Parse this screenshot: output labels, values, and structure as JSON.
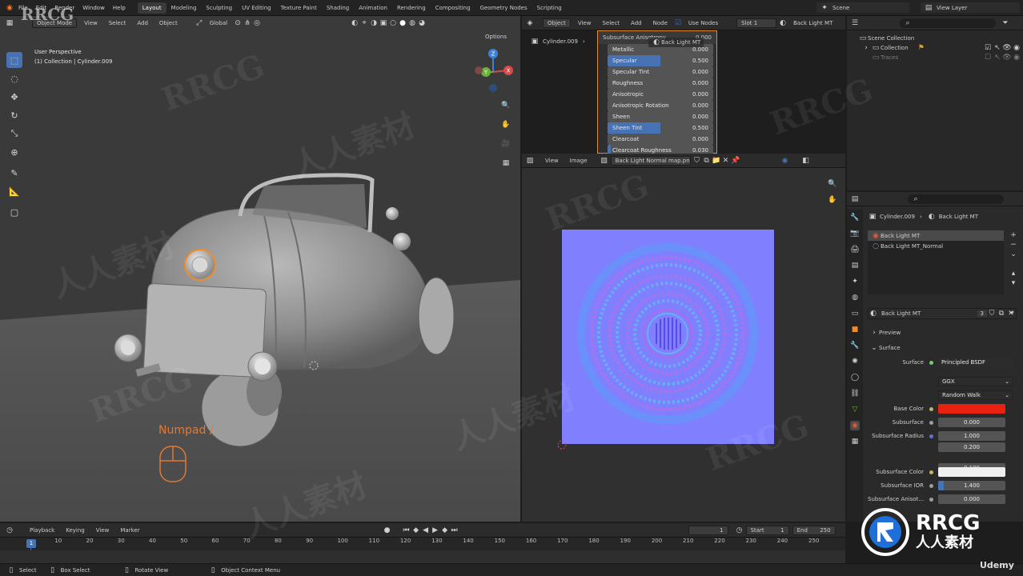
{
  "topbar": {
    "menus": [
      "File",
      "Edit",
      "Render",
      "Window",
      "Help"
    ],
    "workspaces": [
      "Layout",
      "Modeling",
      "Sculpting",
      "UV Editing",
      "Texture Paint",
      "Shading",
      "Animation",
      "Rendering",
      "Compositing",
      "Geometry Nodes",
      "Scripting"
    ],
    "active_workspace": "Layout",
    "scene": "Scene",
    "view_layer": "View Layer"
  },
  "viewport": {
    "mode": "Object Mode",
    "menus": [
      "View",
      "Select",
      "Add",
      "Object"
    ],
    "orientation": "Global",
    "options_label": "Options",
    "overlay_line1": "User Perspective",
    "overlay_line2": "(1) Collection | Cylinder.009",
    "key_hint": "Numpad /",
    "gizmo": {
      "x": "X",
      "y": "Y",
      "z": "Z"
    }
  },
  "shader_editor": {
    "mode": "Object",
    "menus": [
      "View",
      "Select",
      "Add",
      "Node"
    ],
    "use_nodes": "Use Nodes",
    "slot": "Slot 1",
    "material": "Back Light MT",
    "breadcrumb_object": "Cylinder.009",
    "breadcrumb_material": "Back Light MT",
    "node_title": "Subsurface Anisotropy",
    "node_title_value": "0.000",
    "rows": [
      {
        "label": "Metallic",
        "value": "0.000",
        "fill": 0
      },
      {
        "label": "Specular",
        "value": "0.500",
        "fill": 0.5
      },
      {
        "label": "Specular Tint",
        "value": "0.000",
        "fill": 0
      },
      {
        "label": "Roughness",
        "value": "0.000",
        "fill": 0
      },
      {
        "label": "Anisotropic",
        "value": "0.000",
        "fill": 0
      },
      {
        "label": "Anisotropic Rotation",
        "value": "0.000",
        "fill": 0
      },
      {
        "label": "Sheen",
        "value": "0.000",
        "fill": 0
      },
      {
        "label": "Sheen Tint",
        "value": "0.500",
        "fill": 0.5
      },
      {
        "label": "Clearcoat",
        "value": "0.000",
        "fill": 0
      },
      {
        "label": "Clearcoat Roughness",
        "value": "0.030",
        "fill": 0.03
      }
    ]
  },
  "image_editor": {
    "menus": [
      "View",
      "Image"
    ],
    "image_name": "Back Light Normal map.png"
  },
  "outliner": {
    "root": "Scene Collection",
    "collection": "Collection",
    "child": "Traces"
  },
  "properties": {
    "breadcrumb_object": "Cylinder.009",
    "breadcrumb_material": "Back Light MT",
    "slots": [
      "Back Light MT",
      "Back Light MT_Normal"
    ],
    "material_name": "Back Light MT",
    "user_count": "3",
    "preview_label": "Preview",
    "surface_label": "Surface",
    "surface_field_label": "Surface",
    "surface_value": "Principled BSDF",
    "distribution": "GGX",
    "subsurface_method": "Random Walk",
    "base_color_label": "Base Color",
    "base_color": "#e8220e",
    "subsurface_label": "Subsurface",
    "subsurface_value": "0.000",
    "subsurface_radius_label": "Subsurface Radius",
    "radius": [
      "1.000",
      "0.200",
      "0.100"
    ],
    "subsurface_color_label": "Subsurface Color",
    "subsurface_color": "#efefef",
    "subsurface_ior_label": "Subsurface IOR",
    "subsurface_ior_value": "1.400",
    "subsurface_aniso_label": "Subsurface Anisot...",
    "subsurface_aniso_value": "0.000"
  },
  "timeline": {
    "menus": [
      "Playback",
      "Keying",
      "View",
      "Marker"
    ],
    "current_frame": "1",
    "start_label": "Start",
    "start": "1",
    "end_label": "End",
    "end": "250",
    "ticks": [
      "10",
      "20",
      "30",
      "40",
      "50",
      "60",
      "70",
      "80",
      "90",
      "100",
      "110",
      "120",
      "130",
      "140",
      "150",
      "160",
      "170",
      "180",
      "190",
      "200",
      "210",
      "220",
      "230",
      "240",
      "250"
    ]
  },
  "statusbar": {
    "select": "Select",
    "box_select": "Box Select",
    "rotate_view": "Rotate View",
    "context_menu": "Object Context Menu"
  },
  "watermarks": {
    "rrcg": "RRCG",
    "cn": "人人素材",
    "udemy": "Udemy"
  },
  "colors": {
    "accent": "#4772b3",
    "selection": "#f28c2a",
    "normal_map": "#8080ff"
  }
}
